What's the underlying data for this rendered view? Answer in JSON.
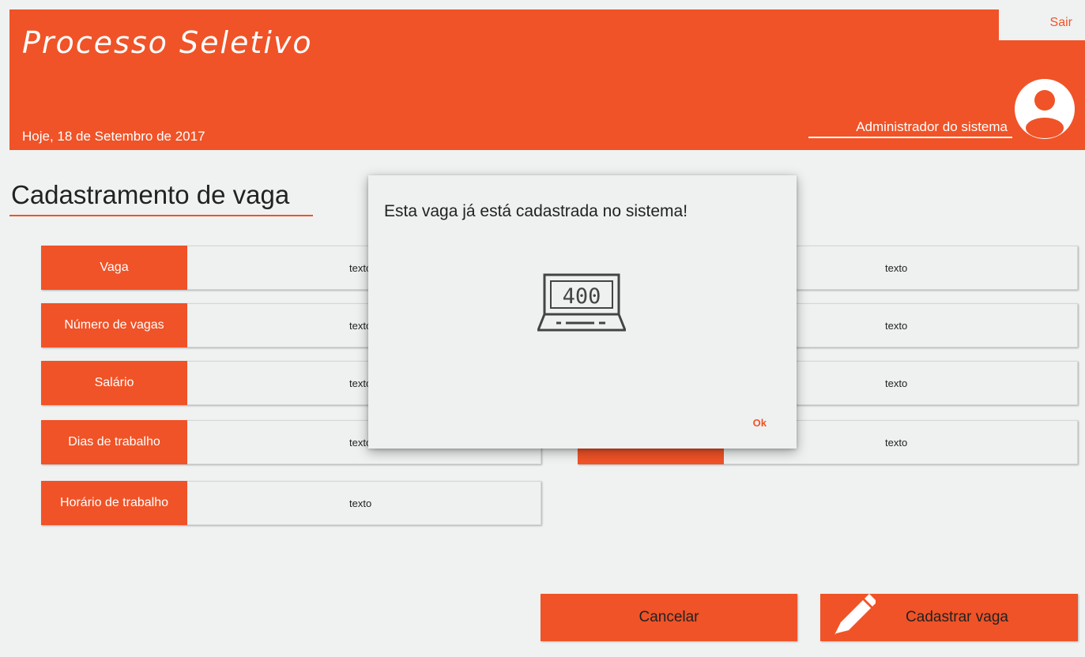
{
  "header": {
    "title": "Processo Seletivo",
    "date": "Hoje, 18 de Setembro de 2017",
    "logout_label": "Sair",
    "user_label": "Administrador do sistema"
  },
  "page": {
    "title": "Cadastramento de vaga"
  },
  "form": {
    "left_fields": [
      {
        "label": "Vaga",
        "value": "texto"
      },
      {
        "label": "Número de vagas",
        "value": "texto"
      },
      {
        "label": "Salário",
        "value": "texto"
      },
      {
        "label": "Dias de trabalho",
        "value": "texto"
      },
      {
        "label": "Horário de trabalho",
        "value": "texto"
      }
    ],
    "right_fields": [
      {
        "label": "",
        "value": "texto"
      },
      {
        "label": "",
        "value": "texto"
      },
      {
        "label": "",
        "value": "texto"
      },
      {
        "label": "",
        "value": "texto"
      }
    ]
  },
  "actions": {
    "cancel_label": "Cancelar",
    "submit_label": "Cadastrar vaga",
    "submit_icon": "pencil-icon"
  },
  "dialog": {
    "message": "Esta vaga já está cadastrada no sistema!",
    "icon": "laptop-error-icon",
    "error_code": "400",
    "ok_label": "Ok"
  },
  "colors": {
    "accent": "#f05327",
    "surface": "#eff1f1",
    "text": "#222222"
  }
}
